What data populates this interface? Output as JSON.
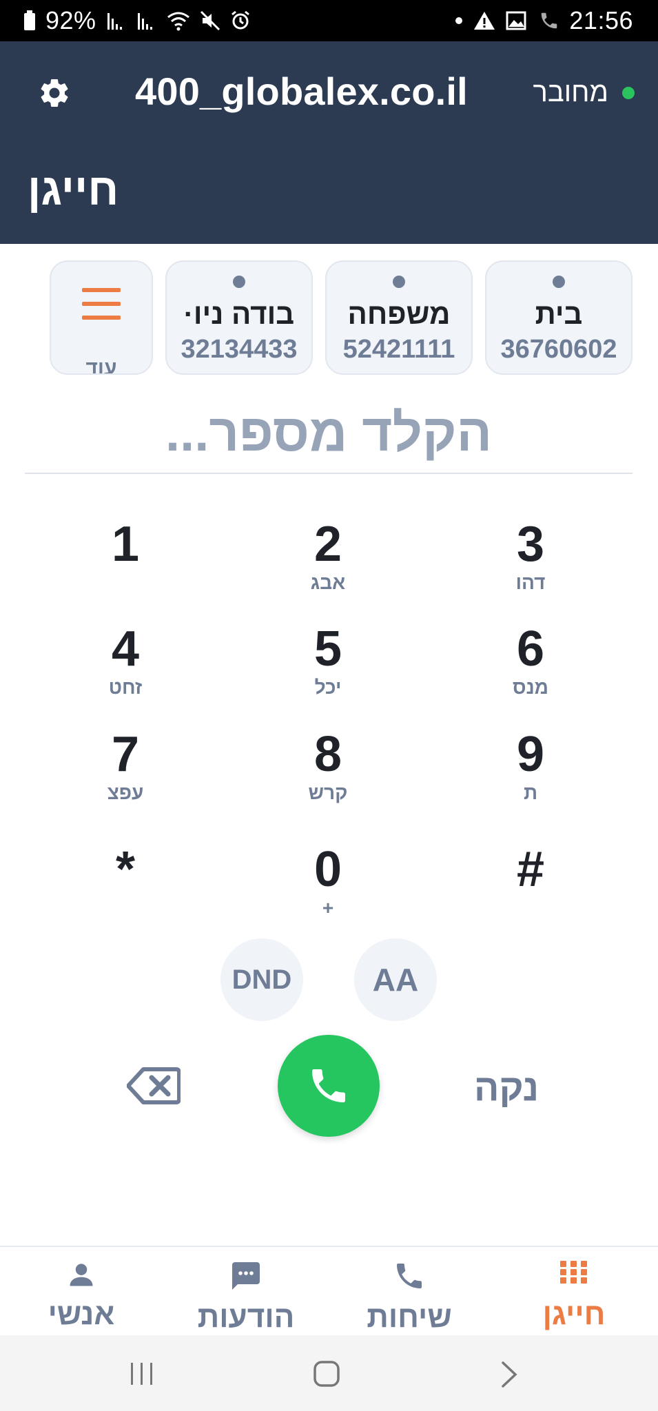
{
  "status_bar": {
    "battery": "92%",
    "time": "21:56"
  },
  "header": {
    "connection_status": "מחובר",
    "account": "400_globalex.co.il",
    "title": "חייגן"
  },
  "quick_dial": [
    {
      "name": "בית",
      "number": "36760602"
    },
    {
      "name": "משפחה",
      "number": "52421111"
    },
    {
      "name": "בודה ניו·",
      "number": "32134433"
    }
  ],
  "more_label": "עוד",
  "dial_input": {
    "placeholder": "הקלד מספר..."
  },
  "keypad": [
    {
      "digit": "1",
      "letters": ""
    },
    {
      "digit": "2",
      "letters": "אבג"
    },
    {
      "digit": "3",
      "letters": "דהו"
    },
    {
      "digit": "4",
      "letters": "זחט"
    },
    {
      "digit": "5",
      "letters": "יכל"
    },
    {
      "digit": "6",
      "letters": "מנס"
    },
    {
      "digit": "7",
      "letters": "עפצ"
    },
    {
      "digit": "8",
      "letters": "קרש"
    },
    {
      "digit": "9",
      "letters": "ת"
    },
    {
      "digit": "*",
      "letters": ""
    },
    {
      "digit": "0",
      "letters": "+"
    },
    {
      "digit": "#",
      "letters": ""
    }
  ],
  "actions": {
    "dnd": "DND",
    "aa": "AA",
    "clear": "נקה"
  },
  "bottom_nav": [
    {
      "label": "חייגן",
      "icon": "dialpad-icon",
      "active": true
    },
    {
      "label": "שיחות",
      "icon": "phone-icon",
      "active": false
    },
    {
      "label": "הודעות",
      "icon": "chat-icon",
      "active": false
    },
    {
      "label": "אנשי קשר",
      "icon": "person-icon",
      "active": false
    }
  ],
  "colors": {
    "header_bg": "#2d3b52",
    "accent": "#ec7c44",
    "call_green": "#25c55f",
    "connected_green": "#2ac35e",
    "muted": "#6e7d95"
  }
}
